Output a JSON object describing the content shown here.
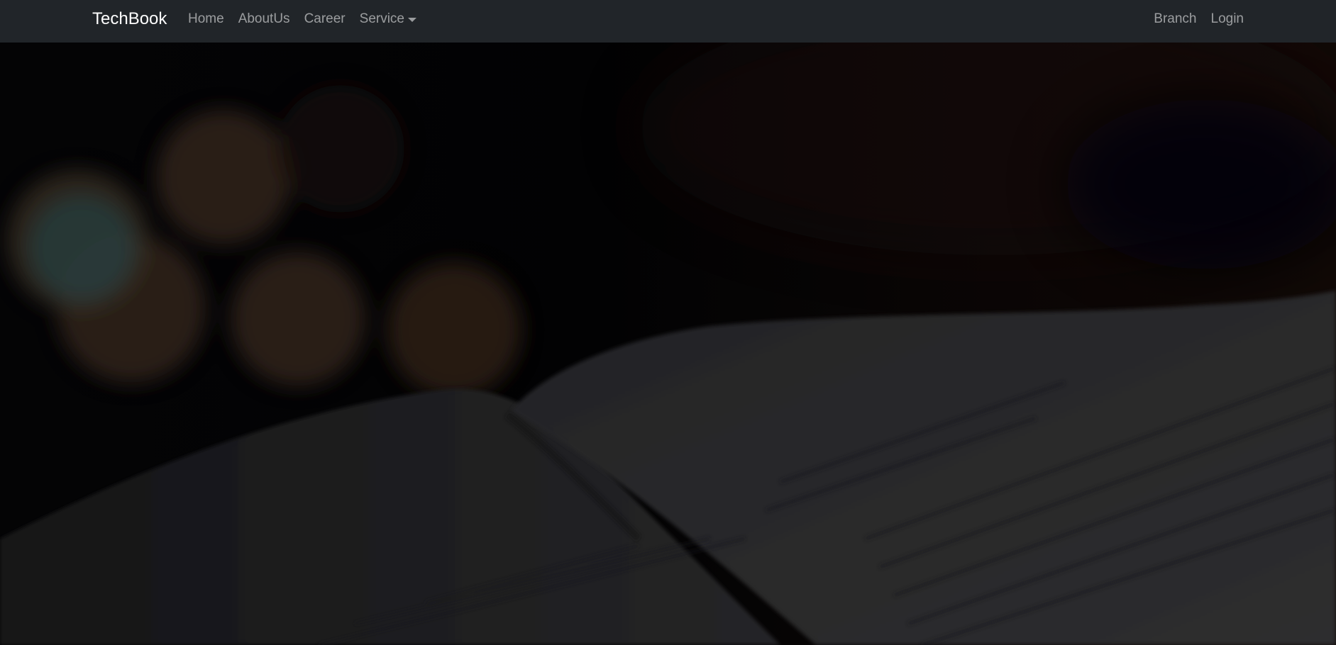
{
  "navbar": {
    "brand": "TechBook",
    "left_items": [
      {
        "label": "Home"
      },
      {
        "label": "AboutUs"
      },
      {
        "label": "Career"
      },
      {
        "label": "Service"
      }
    ],
    "right_items": [
      {
        "label": "Branch"
      },
      {
        "label": "Login"
      }
    ]
  },
  "colors": {
    "navbar_bg": "#212529",
    "brand_text": "#ffffff",
    "link_text": "rgba(255,255,255,0.55)",
    "hero_bg": "#040405"
  },
  "hero": {
    "image": "dimmed-open-book-with-bokeh-lights"
  }
}
